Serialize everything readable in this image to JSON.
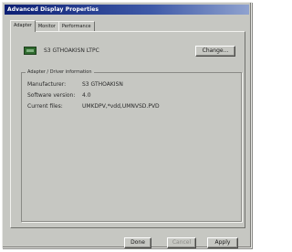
{
  "window": {
    "title": "Advanced Display Properties"
  },
  "tabs": [
    {
      "label": "Adapter",
      "active": true
    },
    {
      "label": "Monitor",
      "active": false
    },
    {
      "label": "Performance",
      "active": false
    }
  ],
  "adapter": {
    "name": "S3 GTHOAKISN LTPC",
    "icon": "display-adapter-icon",
    "change_label": "Change..."
  },
  "group": {
    "legend": "Adapter / Driver information",
    "rows": [
      {
        "label": "Manufacturer:",
        "value": "S3 GTHOAKISN"
      },
      {
        "label": "Software version:",
        "value": "4.0"
      },
      {
        "label": "Current files:",
        "value": "UMKDPV,*vdd,UMNVSD.PVD"
      }
    ]
  },
  "footer": {
    "ok_label": "Done",
    "cancel_label": "Cancel",
    "apply_label": "Apply"
  }
}
